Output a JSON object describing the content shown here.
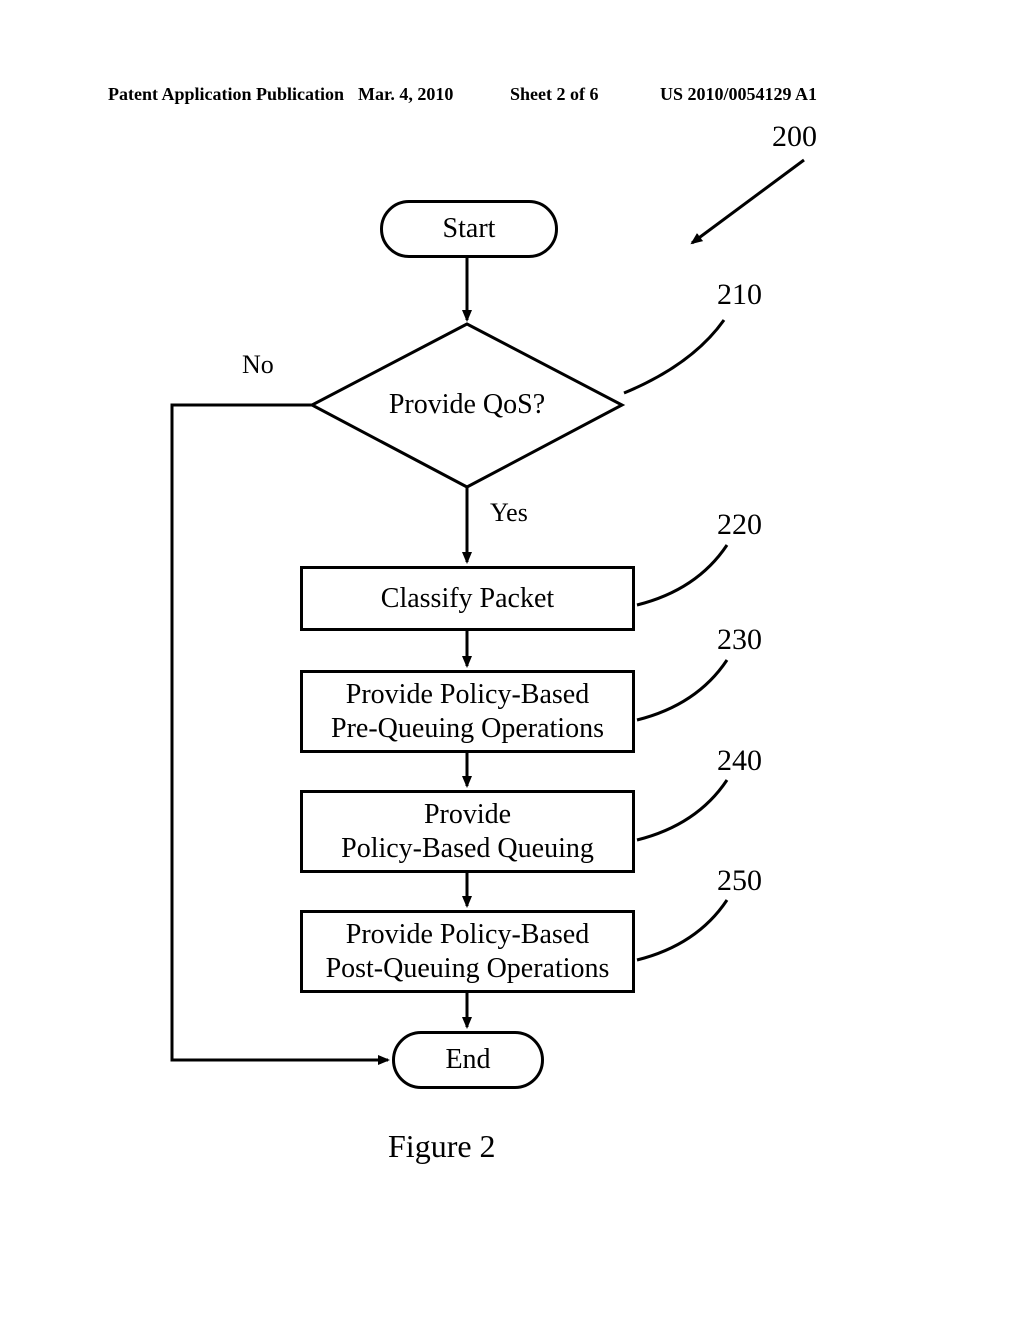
{
  "header": {
    "left": "Patent Application Publication",
    "date": "Mar. 4, 2010",
    "sheet": "Sheet 2 of 6",
    "pub_no": "US 2010/0054129 A1"
  },
  "diagram": {
    "ref_main": "200",
    "start": "Start",
    "decision": {
      "text": "Provide QoS?",
      "ref": "210",
      "no": "No",
      "yes": "Yes"
    },
    "steps": [
      {
        "ref": "220",
        "lines": [
          "Classify Packet"
        ]
      },
      {
        "ref": "230",
        "lines": [
          "Provide Policy-Based",
          "Pre-Queuing Operations"
        ]
      },
      {
        "ref": "240",
        "lines": [
          "Provide",
          "Policy-Based Queuing"
        ]
      },
      {
        "ref": "250",
        "lines": [
          "Provide Policy-Based",
          "Post-Queuing Operations"
        ]
      }
    ],
    "end": "End"
  },
  "caption": "Figure  2"
}
